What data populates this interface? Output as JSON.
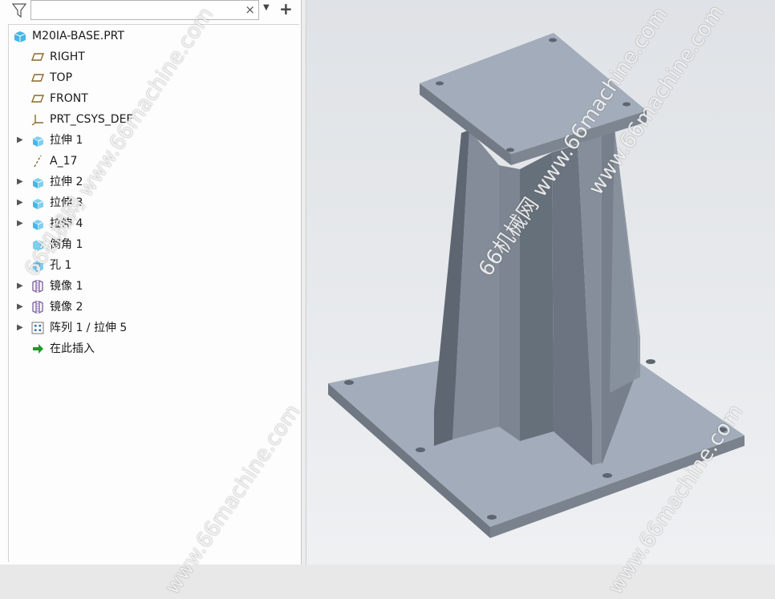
{
  "filter": {
    "placeholder": "",
    "value": ""
  },
  "toolbar": {
    "filter_icon": "filter-icon",
    "clear_icon": "clear-icon",
    "dropdown_icon": "chevron-down-icon",
    "add_icon": "plus-icon"
  },
  "model_tree": {
    "root": {
      "label": "M20IA-BASE.PRT",
      "icon": "part-icon"
    },
    "items": [
      {
        "label": "RIGHT",
        "icon": "datum-plane-icon",
        "expandable": false
      },
      {
        "label": "TOP",
        "icon": "datum-plane-icon",
        "expandable": false
      },
      {
        "label": "FRONT",
        "icon": "datum-plane-icon",
        "expandable": false
      },
      {
        "label": "PRT_CSYS_DEF",
        "icon": "csys-icon",
        "expandable": false
      },
      {
        "label": "拉伸 1",
        "icon": "extrude-icon",
        "expandable": true
      },
      {
        "label": "A_17",
        "icon": "axis-icon",
        "expandable": false
      },
      {
        "label": "拉伸 2",
        "icon": "extrude-icon",
        "expandable": true
      },
      {
        "label": "拉伸 3",
        "icon": "extrude-icon",
        "expandable": true
      },
      {
        "label": "拉伸 4",
        "icon": "extrude-icon",
        "expandable": true
      },
      {
        "label": "倒角 1",
        "icon": "chamfer-icon",
        "expandable": false
      },
      {
        "label": "孔 1",
        "icon": "hole-icon",
        "expandable": false
      },
      {
        "label": "镜像 1",
        "icon": "mirror-icon",
        "expandable": true
      },
      {
        "label": "镜像 2",
        "icon": "mirror-icon",
        "expandable": true
      },
      {
        "label": "阵列 1 / 拉伸 5",
        "icon": "pattern-icon",
        "expandable": true
      },
      {
        "label": "在此插入",
        "icon": "insert-here-arrow-icon",
        "expandable": false
      }
    ]
  },
  "watermarks": [
    "66机械网 www.66machine.com",
    "66机械网 www.66machine.com",
    "www.66machine.com",
    "www.66machine.com",
    "www.66machine.com"
  ],
  "colors": {
    "model_top": "#9ea8b6",
    "model_side": "#6c7480",
    "model_dark": "#59606b",
    "background": "#e8eaed"
  }
}
